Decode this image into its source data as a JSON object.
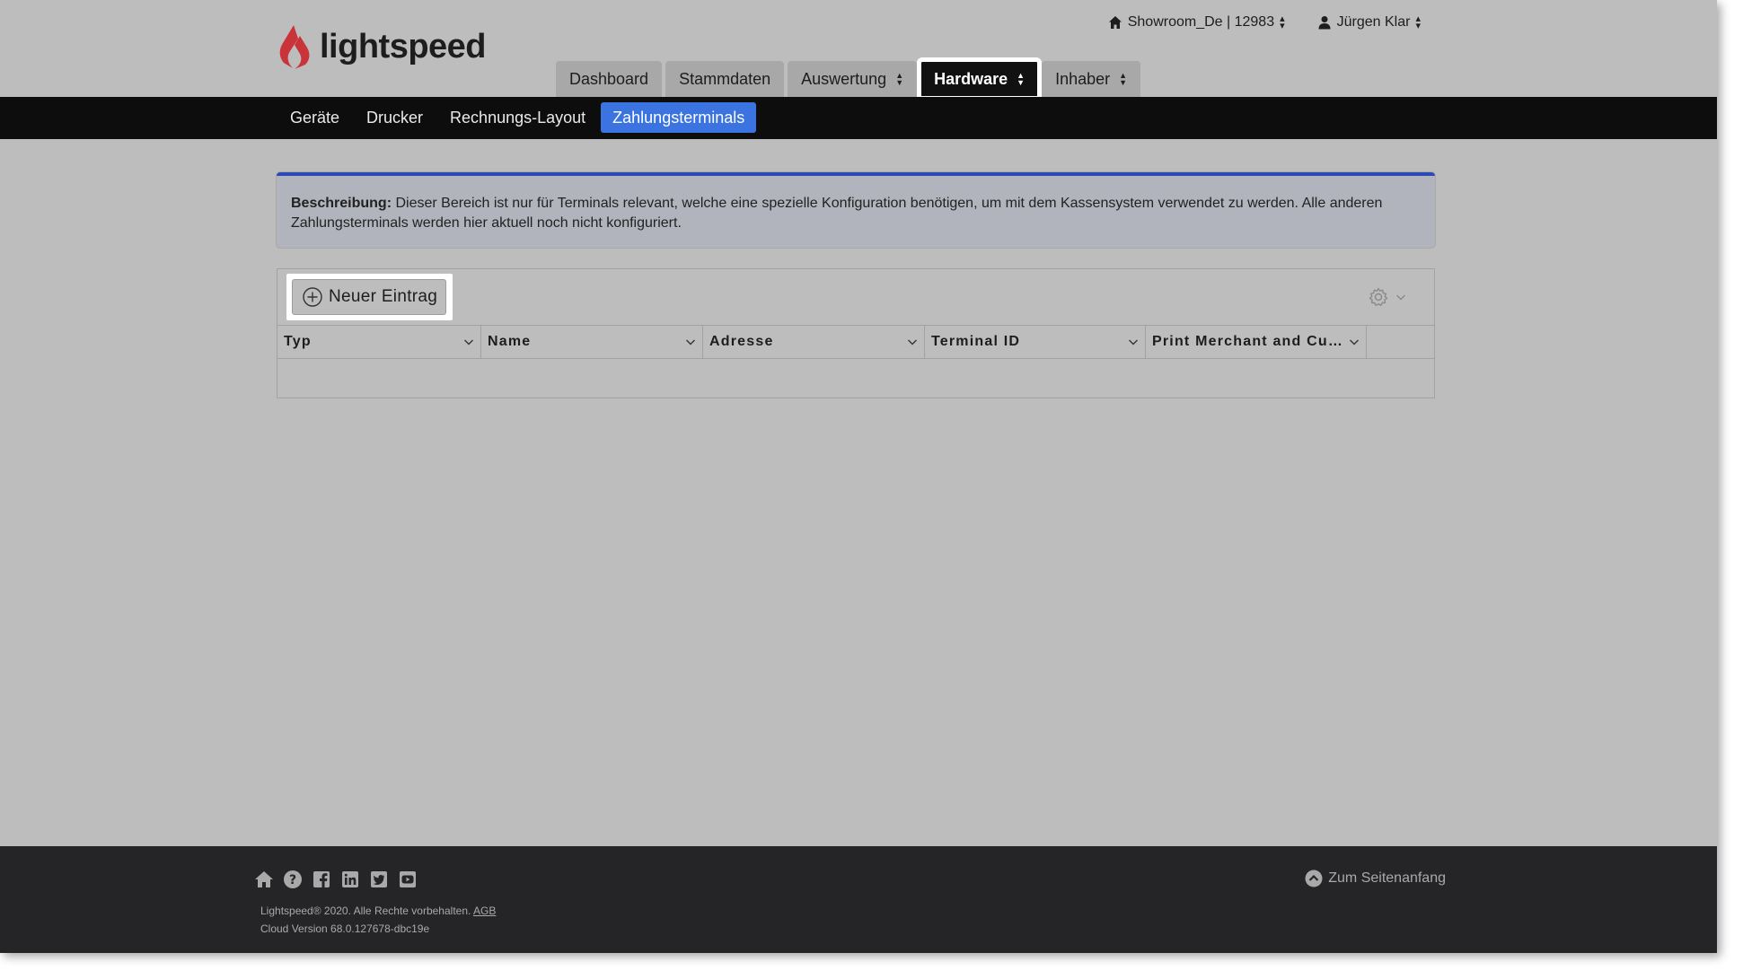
{
  "brand": {
    "name": "lightspeed",
    "accent": "#c8343a"
  },
  "top_right": {
    "location": "Showroom_De | 12983",
    "user": "Jürgen Klar"
  },
  "tabs": [
    {
      "label": "Dashboard",
      "active": false
    },
    {
      "label": "Stammdaten",
      "active": false
    },
    {
      "label": "Auswertung",
      "active": false
    },
    {
      "label": "Hardware",
      "active": true
    },
    {
      "label": "Inhaber",
      "active": false
    }
  ],
  "subnav": [
    {
      "label": "Geräte",
      "active": false
    },
    {
      "label": "Drucker",
      "active": false
    },
    {
      "label": "Rechnungs-Layout",
      "active": false
    },
    {
      "label": "Zahlungsterminals",
      "active": true
    }
  ],
  "description": {
    "label": "Beschreibung:",
    "text": "Dieser Bereich ist nur für Terminals relevant, welche eine spezielle Konfiguration benötigen, um mit dem Kassensystem verwendet zu werden. Alle anderen Zahlungsterminals werden hier aktuell noch nicht konfiguriert."
  },
  "toolbar": {
    "new_entry_label": "Neuer Eintrag",
    "settings_icon": "gear-icon"
  },
  "table": {
    "columns": [
      "Typ",
      "Name",
      "Adresse",
      "Terminal ID",
      "Print Merchant and Customer Receipt"
    ],
    "rows": []
  },
  "footer": {
    "social_icons": [
      "home-icon",
      "help-icon",
      "facebook-icon",
      "linkedin-icon",
      "twitter-icon",
      "youtube-icon"
    ],
    "copyright": "Lightspeed® 2020. Alle Rechte vorbehalten.",
    "agb_link": "AGB",
    "version": "Cloud Version 68.0.127678-dbc19e",
    "back_to_top": "Zum Seitenanfang"
  }
}
